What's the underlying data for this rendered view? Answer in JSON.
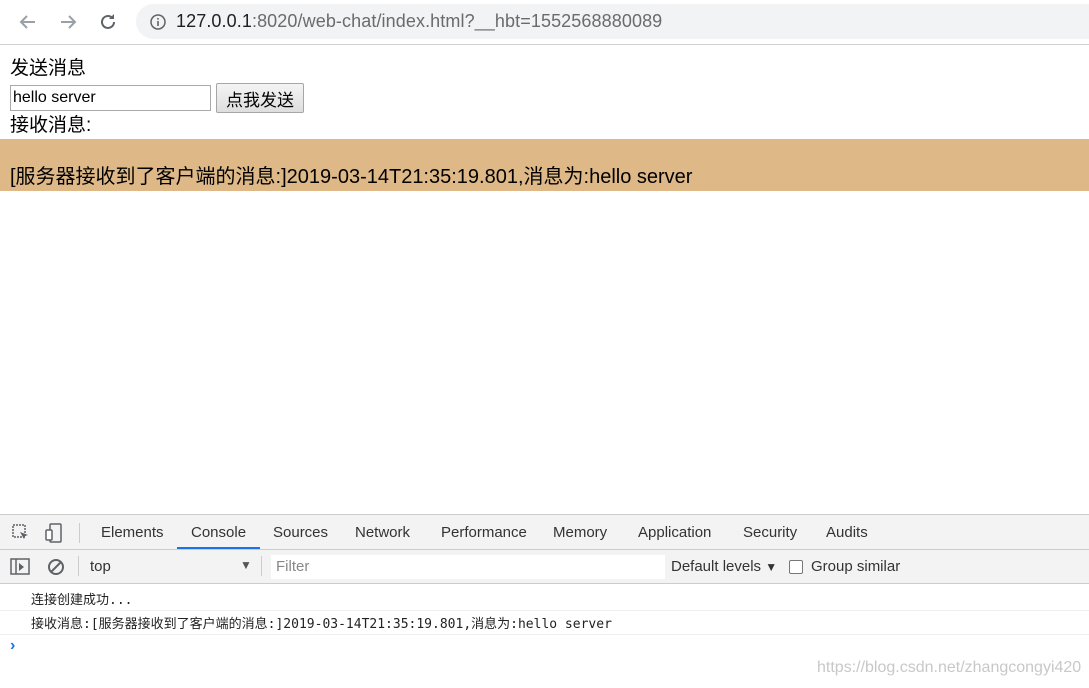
{
  "browser": {
    "url_host": "127.0.0.1",
    "url_rest": ":8020/web-chat/index.html?__hbt=1552568880089",
    "icons": {
      "back": "back-arrow-icon",
      "forward": "forward-arrow-icon",
      "reload": "reload-icon",
      "info": "info-icon"
    }
  },
  "page": {
    "send_title": "发送消息",
    "input_value": "hello server",
    "send_button": "点我发送",
    "recv_title": "接收消息:",
    "recv_message": "[服务器接收到了客户端的消息:]2019-03-14T21:35:19.801,消息为:hello server",
    "recv_bg": "#deb887"
  },
  "devtools": {
    "tabs": [
      "Elements",
      "Console",
      "Sources",
      "Network",
      "Performance",
      "Memory",
      "Application",
      "Security",
      "Audits"
    ],
    "active_tab": "Console",
    "context": "top",
    "filter_placeholder": "Filter",
    "levels": "Default levels",
    "group_similar": "Group similar",
    "console_lines": [
      "连接创建成功...",
      "接收消息:[服务器接收到了客户端的消息:]2019-03-14T21:35:19.801,消息为:hello server"
    ],
    "accent": "#1a73e8"
  },
  "watermark": "https://blog.csdn.net/zhangcongyi420"
}
